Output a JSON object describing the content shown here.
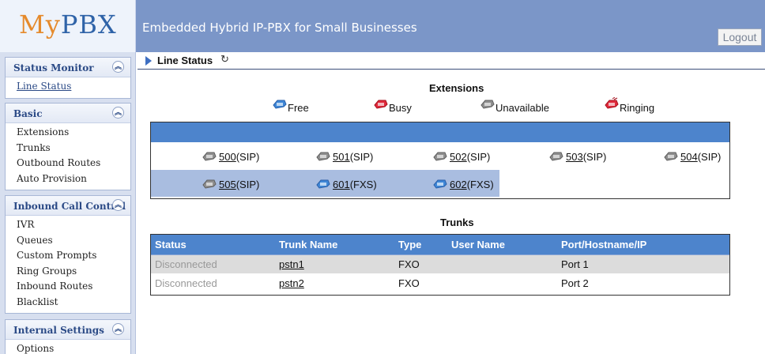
{
  "header": {
    "logo_my": "My",
    "logo_pbx": "PBX",
    "title": "Embedded Hybrid IP-PBX for Small Businesses",
    "logout_label": "Logout"
  },
  "sidebar": {
    "panels": [
      {
        "title": "Status Monitor",
        "items": [
          "Line Status"
        ]
      },
      {
        "title": "Basic",
        "items": [
          "Extensions",
          "Trunks",
          "Outbound Routes",
          "Auto Provision"
        ]
      },
      {
        "title": "Inbound Call Control",
        "items": [
          "IVR",
          "Queues",
          "Custom Prompts",
          "Ring Groups",
          "Inbound Routes",
          "Blacklist"
        ]
      },
      {
        "title": "Internal Settings",
        "items": [
          "Options"
        ]
      }
    ]
  },
  "main": {
    "breadcrumb": "Line Status",
    "extensions_title": "Extensions",
    "legend": [
      {
        "label": "Free",
        "color": "#3e86d6"
      },
      {
        "label": "Busy",
        "color": "#e0283a"
      },
      {
        "label": "Unavailable",
        "color": "#8e8e8e"
      },
      {
        "label": "Ringing",
        "color": "#e0283a"
      }
    ],
    "extensions": [
      {
        "number": "500",
        "type": "(SIP)",
        "state": "Unavailable"
      },
      {
        "number": "501",
        "type": "(SIP)",
        "state": "Unavailable"
      },
      {
        "number": "502",
        "type": "(SIP)",
        "state": "Unavailable"
      },
      {
        "number": "503",
        "type": "(SIP)",
        "state": "Unavailable"
      },
      {
        "number": "504",
        "type": "(SIP)",
        "state": "Unavailable"
      },
      {
        "number": "505",
        "type": "(SIP)",
        "state": "Unavailable"
      },
      {
        "number": "601",
        "type": "(FXS)",
        "state": "Free"
      },
      {
        "number": "602",
        "type": "(FXS)",
        "state": "Free"
      }
    ],
    "trunks_title": "Trunks",
    "trunk_columns": [
      "Status",
      "Trunk Name",
      "Type",
      "User Name",
      "Port/Hostname/IP"
    ],
    "trunks": [
      {
        "status": "Disconnected",
        "name": "pstn1",
        "type": "FXO",
        "user": "",
        "port": "Port 1"
      },
      {
        "status": "Disconnected",
        "name": "pstn2",
        "type": "FXO",
        "user": "",
        "port": "Port 2"
      }
    ]
  },
  "colors": {
    "header_bg": "#7b96c8",
    "table_header": "#4d84cc",
    "row_highlight": "#a9bde0",
    "sidebar_bg": "#d7dfef"
  }
}
